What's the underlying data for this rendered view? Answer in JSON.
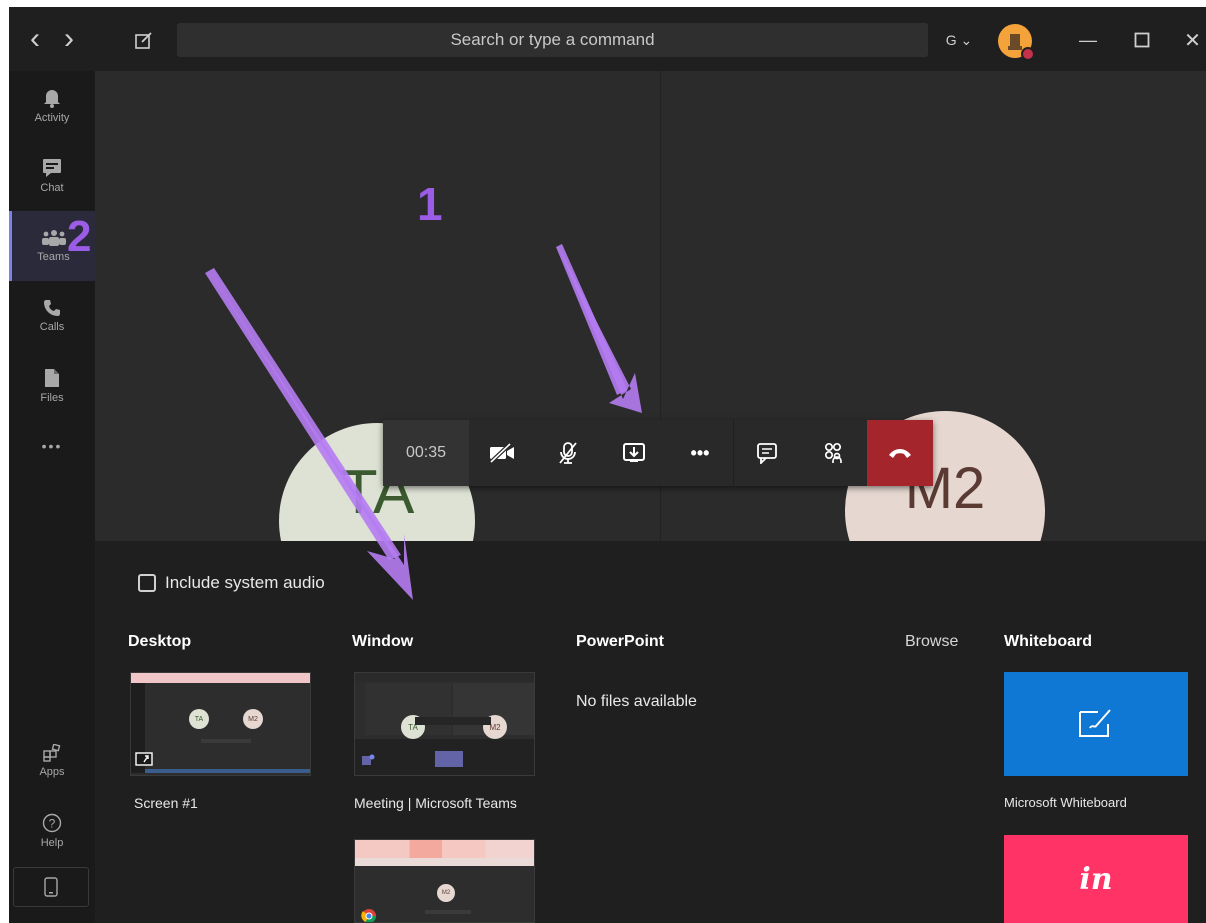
{
  "titlebar": {
    "back_glyph": "‹",
    "forward_glyph": "›",
    "search_placeholder": "Search or type a command",
    "account_menu": "G ⌄",
    "minimize_glyph": "—",
    "close_glyph": "✕"
  },
  "rail": {
    "items": [
      {
        "label": "Activity",
        "icon": "bell-icon"
      },
      {
        "label": "Chat",
        "icon": "chat-icon"
      },
      {
        "label": "Teams",
        "icon": "teams-icon"
      },
      {
        "label": "Calls",
        "icon": "phone-icon"
      },
      {
        "label": "Files",
        "icon": "file-icon"
      }
    ],
    "more": "•••",
    "apps_label": "Apps",
    "help_label": "Help"
  },
  "stage": {
    "participant_left": "TA",
    "participant_right": "M2"
  },
  "callbar": {
    "timer": "00:35",
    "more_glyph": "•••"
  },
  "annotations": {
    "label_1": "1",
    "label_2": "2"
  },
  "share": {
    "include_audio_label": "Include system audio",
    "sections": {
      "desktop": "Desktop",
      "window": "Window",
      "powerpoint": "PowerPoint",
      "browse": "Browse",
      "whiteboard": "Whiteboard"
    },
    "desktop_items": [
      "Screen #1"
    ],
    "window_items": [
      "Meeting | Microsoft Teams"
    ],
    "powerpoint_empty": "No files available",
    "whiteboard_items": [
      "Microsoft Whiteboard"
    ],
    "invision_glyph": "in",
    "thumb_left": "TA",
    "thumb_right": "M2"
  },
  "colors": {
    "accent": "#7b83eb",
    "hangup": "#a4262c",
    "annotation": "#9b5de5",
    "whiteboard": "#0f78d4",
    "invision": "#ff3366"
  }
}
